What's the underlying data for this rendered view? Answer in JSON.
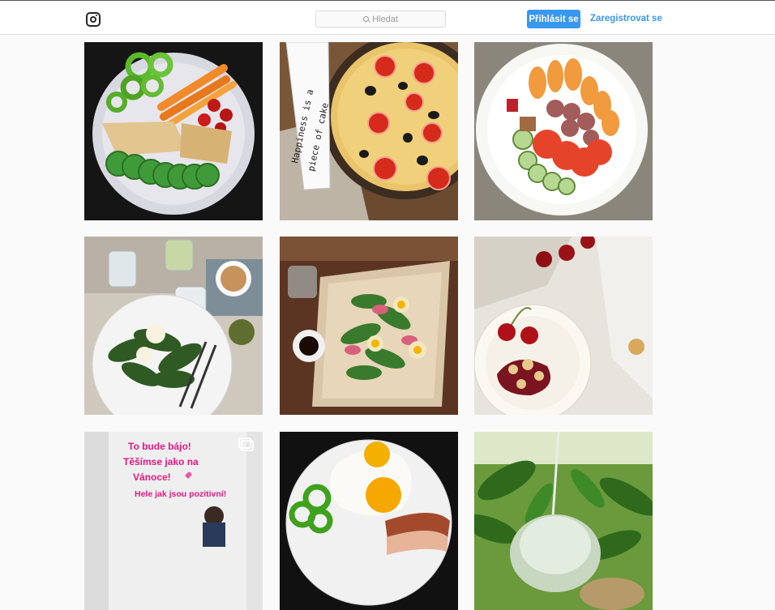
{
  "header": {
    "search_placeholder": "Hledat",
    "login_label": "Přihlásit se",
    "register_label": "Zaregistrovat se"
  },
  "posts": [
    {
      "id": "post-1",
      "desc": "plate-peppers-carrots-hummus"
    },
    {
      "id": "post-2",
      "desc": "quiche-tomatoes-olives"
    },
    {
      "id": "post-3",
      "desc": "plate-apricots-tomatoes-ham"
    },
    {
      "id": "post-4",
      "desc": "salad-eggs-coffee"
    },
    {
      "id": "post-5",
      "desc": "salad-on-baking-paper"
    },
    {
      "id": "post-6",
      "desc": "cherries-crumble-plate"
    },
    {
      "id": "post-7",
      "desc": "story-text"
    },
    {
      "id": "post-8",
      "desc": "fried-egg-bacon"
    },
    {
      "id": "post-9",
      "desc": "coconut-palm"
    }
  ],
  "sign": {
    "line1": "Happiness is a",
    "line2": "piece of cake"
  },
  "story": {
    "line1": "To bude bájo!",
    "line2": "Těšímse jako na",
    "line3": "Vánoce!",
    "line4": "Hele jak jsou pozitivní!"
  },
  "colors": {
    "accent": "#3897f0",
    "story_pink": "#e5197f"
  }
}
